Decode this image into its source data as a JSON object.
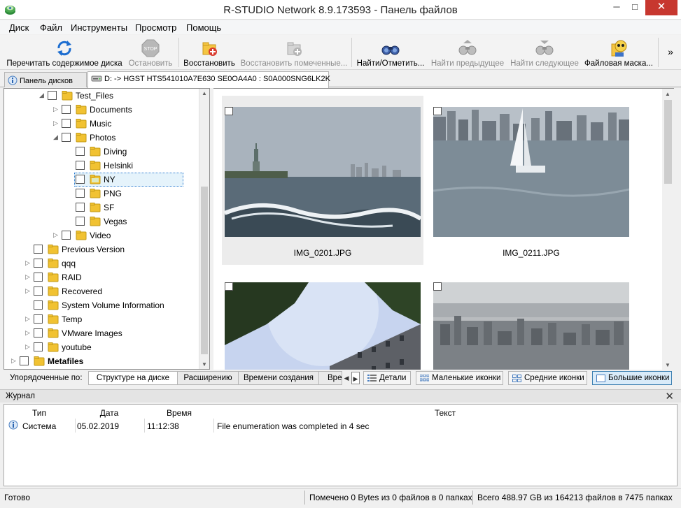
{
  "window": {
    "title": "R-STUDIO Network 8.9.173593 - Панель файлов",
    "min_glyph": "─",
    "max_glyph": "□",
    "close_glyph": "✕"
  },
  "menu": [
    "Диск",
    "Файл",
    "Инструменты",
    "Просмотр",
    "Помощь"
  ],
  "toolbar": {
    "buttons": [
      {
        "label": "Перечитать содержимое диска",
        "icon": "refresh-icon",
        "enabled": true
      },
      {
        "label": "Остановить",
        "icon": "stop-icon",
        "enabled": false
      },
      {
        "label": "Восстановить",
        "icon": "recover-icon",
        "enabled": true
      },
      {
        "label": "Восстановить помеченные...",
        "icon": "recover-marked-icon",
        "enabled": false
      },
      {
        "label": "Найти/Отметить...",
        "icon": "binoculars-icon",
        "enabled": true
      },
      {
        "label": "Найти предыдущее",
        "icon": "find-previous-icon",
        "enabled": false
      },
      {
        "label": "Найти следующее",
        "icon": "find-next-icon",
        "enabled": false
      },
      {
        "label": "Файловая маска...",
        "icon": "file-mask-icon",
        "enabled": true
      }
    ],
    "more_glyph": "»"
  },
  "tabs": [
    {
      "label": "Панель дисков",
      "icon": "drives-panel-icon"
    },
    {
      "label": "D: -> HGST HTS541010A7E630 SE0OA4A0 : S0A000SNG6LK2K",
      "icon": "disk-icon"
    }
  ],
  "tree": {
    "items": [
      {
        "label": "Test_Files",
        "level": 3,
        "expander": "◢",
        "bold": false
      },
      {
        "label": "Documents",
        "level": 4,
        "expander": "▷",
        "bold": false
      },
      {
        "label": "Music",
        "level": 4,
        "expander": "▷",
        "bold": false
      },
      {
        "label": "Photos",
        "level": 4,
        "expander": "◢",
        "bold": false
      },
      {
        "label": "Diving",
        "level": 5,
        "expander": "",
        "bold": false
      },
      {
        "label": "Helsinki",
        "level": 5,
        "expander": "",
        "bold": false
      },
      {
        "label": "NY",
        "level": 5,
        "expander": "",
        "bold": false,
        "selected": true
      },
      {
        "label": "PNG",
        "level": 5,
        "expander": "",
        "bold": false
      },
      {
        "label": "SF",
        "level": 5,
        "expander": "",
        "bold": false
      },
      {
        "label": "Vegas",
        "level": 5,
        "expander": "",
        "bold": false
      },
      {
        "label": "Video",
        "level": 4,
        "expander": "▷",
        "bold": false
      },
      {
        "label": "Previous Version",
        "level": 2,
        "expander": "",
        "bold": false
      },
      {
        "label": "qqq",
        "level": 2,
        "expander": "▷",
        "bold": false
      },
      {
        "label": "RAID",
        "level": 2,
        "expander": "▷",
        "bold": false
      },
      {
        "label": "Recovered",
        "level": 2,
        "expander": "▷",
        "bold": false
      },
      {
        "label": "System Volume Information",
        "level": 2,
        "expander": "",
        "bold": false
      },
      {
        "label": "Temp",
        "level": 2,
        "expander": "▷",
        "bold": false
      },
      {
        "label": "VMware Images",
        "level": 2,
        "expander": "▷",
        "bold": false
      },
      {
        "label": "youtube",
        "level": 2,
        "expander": "▷",
        "bold": false
      },
      {
        "label": "Metafiles",
        "level": 1,
        "expander": "▷",
        "bold": true
      }
    ]
  },
  "thumbnails": [
    {
      "name": "IMG_0201.JPG",
      "scene": "statue-of-liberty",
      "highlighted": true
    },
    {
      "name": "IMG_0211.JPG",
      "scene": "sailboat-manhattan",
      "highlighted": false
    },
    {
      "name": "",
      "scene": "building-sky",
      "highlighted": false
    },
    {
      "name": "",
      "scene": "city-aerial",
      "highlighted": false
    }
  ],
  "sortbar": {
    "label": "Упорядоченные по:",
    "tabs": [
      "Структуре на диске",
      "Расширению",
      "Времени создания",
      "Вре"
    ],
    "active_tab": 0,
    "prev_glyph": "◀",
    "next_glyph": "▶"
  },
  "views": [
    {
      "label": "Детали",
      "icon": "details-view-icon",
      "active": false
    },
    {
      "label": "Маленькие иконки",
      "icon": "small-icons-view-icon",
      "active": false
    },
    {
      "label": "Средние иконки",
      "icon": "medium-icons-view-icon",
      "active": false
    },
    {
      "label": "Большие иконки",
      "icon": "large-icons-view-icon",
      "active": true
    }
  ],
  "journal": {
    "title": "Журнал",
    "close_glyph": "✕",
    "columns": [
      "Тип",
      "Дата",
      "Время",
      "Текст"
    ],
    "rows": [
      {
        "type": "Система",
        "date": "05.02.2019",
        "time": "11:12:38",
        "text": "File enumeration was completed in 4 sec"
      }
    ]
  },
  "status": {
    "ready": "Готово",
    "marked": "Помечено 0 Bytes из 0 файлов в 0 папках",
    "total": "Всего 488.97 GB из 164213 файлов в 7475 папках"
  },
  "colors": {
    "folder": "#f1c232",
    "close_button": "#c7372f",
    "selection": "#e5f3fb",
    "active_view": "#d9ebf9"
  }
}
